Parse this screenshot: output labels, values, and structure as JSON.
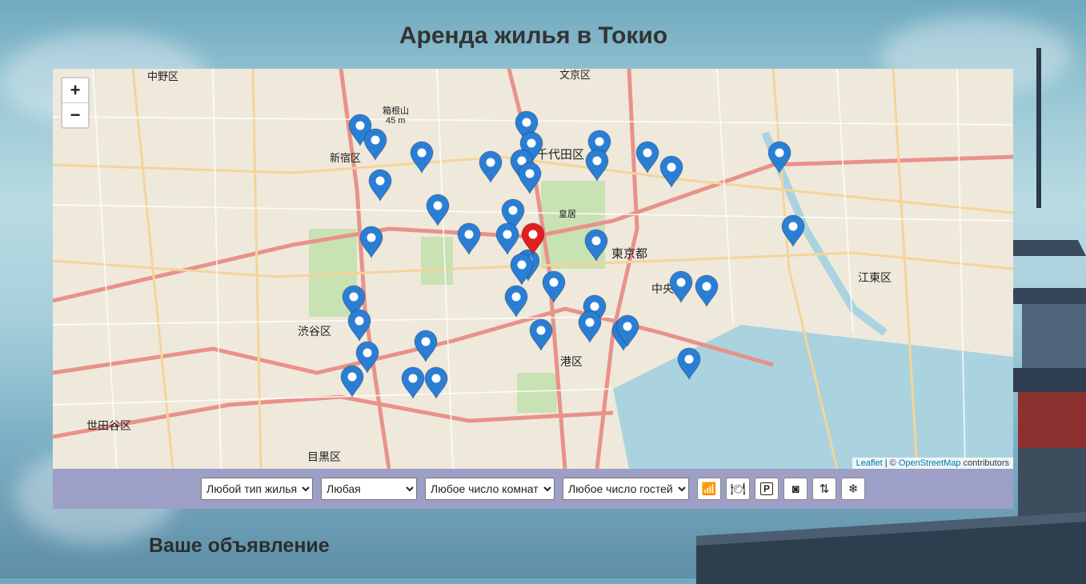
{
  "page": {
    "title": "Аренда жилья в Токио"
  },
  "map": {
    "zoom_in": "+",
    "zoom_out": "−",
    "attribution": {
      "leaflet": "Leaflet",
      "separator": " | © ",
      "osm": "OpenStreetMap",
      "suffix": " contributors"
    },
    "labels": [
      "中野区",
      "文京区",
      "新宿区",
      "千代田区",
      "東京都",
      "中央区",
      "江東区",
      "港区",
      "渋谷区",
      "世田谷区",
      "目黒区",
      "皇居",
      "箱根山",
      "45 m"
    ],
    "marker_colors": {
      "default": "#2a7fd4",
      "selected": "#e02020"
    }
  },
  "filters": {
    "housing_type": "Любой тип жилья",
    "district": "Любая",
    "rooms": "Любое число комнат",
    "guests": "Любое число гостей",
    "amenities": [
      {
        "name": "wifi-icon",
        "glyph": "📶"
      },
      {
        "name": "restaurant-icon",
        "glyph": "🍽"
      },
      {
        "name": "parking-icon",
        "glyph": "P"
      },
      {
        "name": "washer-icon",
        "glyph": "◙"
      },
      {
        "name": "elevator-icon",
        "glyph": "⇅"
      },
      {
        "name": "air-conditioner-icon",
        "glyph": "❄"
      }
    ]
  },
  "section": {
    "your_listing": "Ваше объявление"
  }
}
